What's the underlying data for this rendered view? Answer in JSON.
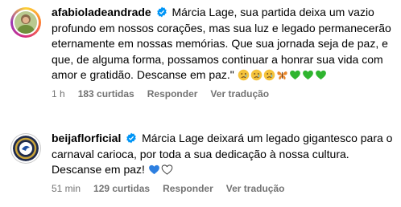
{
  "comments": [
    {
      "username": "afabioladeandrade",
      "text": "Márcia Lage, sua partida deixa um vazio profundo em nossos corações, mas sua luz e legado permanecerão eternamente em nossas memórias. Que sua jornada seja de paz, e que, de alguma forma, possamos continuar a honrar sua vida com amor e gratidão. Descanse em paz.\"",
      "emojis": [
        "crying-face",
        "crying-face",
        "crying-face",
        "butterfly",
        "green-heart",
        "green-heart",
        "green-heart"
      ],
      "time": "1 h",
      "likes": "183 curtidas",
      "reply": "Responder",
      "translate": "Ver tradução"
    },
    {
      "username": "beijaflorficial",
      "text": "Márcia Lage deixará um legado gigantesco para o carnaval carioca, por toda a sua dedicação à nossa cultura. Descanse em paz!",
      "emojis": [
        "blue-heart",
        "white-heart"
      ],
      "time": "51 min",
      "likes": "129 curtidas",
      "reply": "Responder",
      "translate": "Ver tradução"
    }
  ],
  "colors": {
    "verified": "#0095f6",
    "meta": "#737373"
  }
}
